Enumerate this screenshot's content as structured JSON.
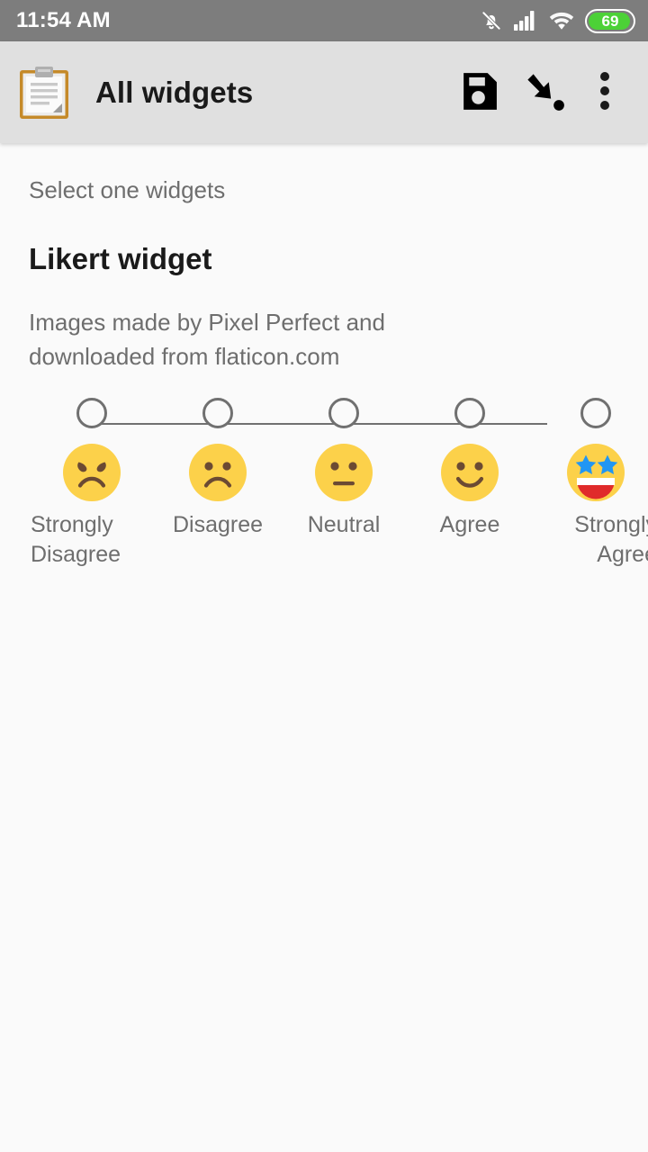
{
  "status_bar": {
    "time": "11:54 AM",
    "icons": [
      "bell-mute-icon",
      "signal-bars-icon",
      "wifi-icon"
    ],
    "battery": {
      "level": "69",
      "fill_color": "#4CD137"
    },
    "background": "#7D7D7D"
  },
  "app_bar": {
    "app_icon": "clipboard-icon",
    "title": "All widgets",
    "actions": [
      {
        "name": "save-button",
        "icon": "floppy-disk-icon"
      },
      {
        "name": "load-button",
        "icon": "arrow-down-right-icon"
      },
      {
        "name": "overflow-menu-button",
        "icon": "more-vertical-icon"
      }
    ],
    "background": "#E0E0E0"
  },
  "main": {
    "select_hint": "Select one widgets",
    "widget_title": "Likert widget",
    "credit": "Images made by Pixel Perfect and downloaded from flaticon.com",
    "likert": {
      "selected_index": null,
      "track_color": "#707070",
      "face_color": "#FCD14A",
      "options": [
        {
          "label": "Strongly Disagree",
          "face": "angry-face-icon",
          "value": 1
        },
        {
          "label": "Disagree",
          "face": "frowning-face-icon",
          "value": 2
        },
        {
          "label": "Neutral",
          "face": "neutral-face-icon",
          "value": 3
        },
        {
          "label": "Agree",
          "face": "smiling-face-icon",
          "value": 4
        },
        {
          "label": "Strongly Agree",
          "face": "star-struck-face-icon",
          "value": 5
        }
      ]
    }
  }
}
